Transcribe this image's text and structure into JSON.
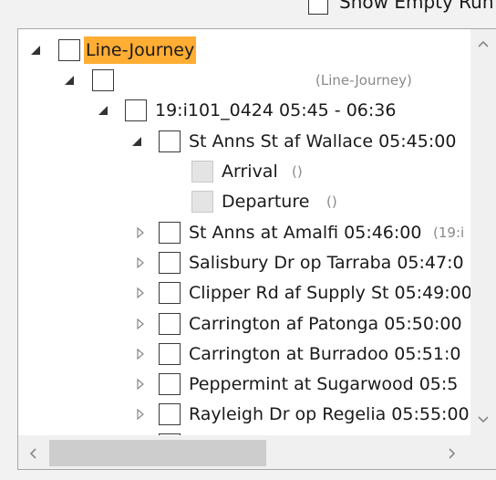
{
  "top": {
    "show_empty_label": "Show Empty Run"
  },
  "tree": {
    "root": {
      "label": "Line-Journey"
    },
    "group": {
      "label": "(Line-Journey)"
    },
    "journey": {
      "label": "19:i101_0424 05:45 - 06:36"
    },
    "stop_open": {
      "label": "St Anns St af Wallace 05:45:00"
    },
    "arrival": {
      "label": "Arrival",
      "count": "()"
    },
    "departure": {
      "label": "Departure",
      "count": "()"
    },
    "stops": [
      {
        "label": "St Anns at Amalfi 05:46:00",
        "suffix": "(19:i"
      },
      {
        "label": "Salisbury Dr op Tarraba 05:47:0"
      },
      {
        "label": "Clipper Rd af Supply St 05:49:00"
      },
      {
        "label": "Carrington af Patonga 05:50:00"
      },
      {
        "label": "Carrington at Burradoo 05:51:0"
      },
      {
        "label": "Peppermint at Sugarwood 05:5"
      },
      {
        "label": "Rayleigh Dr op Regelia 05:55:00"
      }
    ]
  },
  "colors": {
    "selection": "#ffad33"
  }
}
